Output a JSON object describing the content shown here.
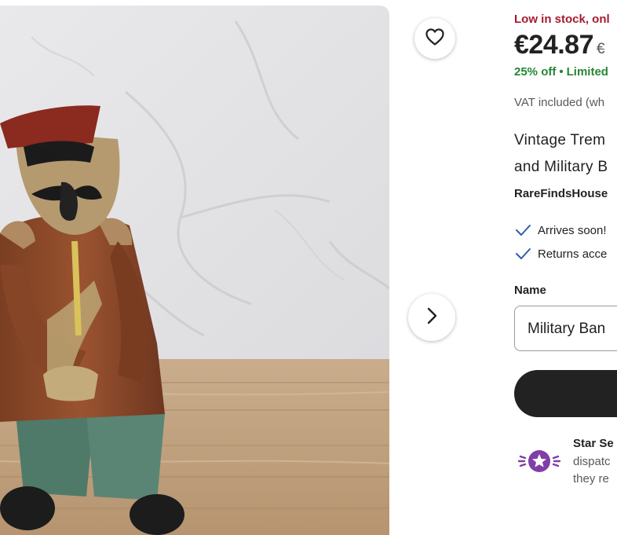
{
  "product": {
    "stock_text": "Low in stock, onl",
    "price": "€24.87",
    "original_price": "€",
    "discount": "25% off",
    "discount_dot": "•",
    "discount_note": "Limited",
    "vat_text": "VAT included (wh",
    "title_line1": "Vintage Trem",
    "title_line2": "and Military B",
    "shop_name": "RareFindsHouse",
    "perks": [
      "Arrives soon!",
      "Returns acce"
    ],
    "option_label": "Name",
    "option_value": "Military Ban"
  },
  "seller_badge": {
    "title": "Star Se",
    "line1": "dispatc",
    "line2": "they re"
  },
  "icons": {
    "favorite": "heart-icon",
    "next": "chevron-right-icon",
    "check": "check-icon",
    "star_seller": "star-seller-badge-icon"
  },
  "colors": {
    "stock": "#a61a2e",
    "discount": "#258635",
    "badge_purple": "#7f3ea8",
    "cta": "#222222"
  }
}
